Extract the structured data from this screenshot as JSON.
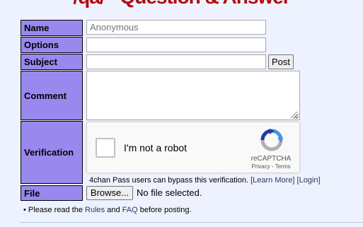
{
  "board": {
    "title": "/qa/ - Question & Answer"
  },
  "form": {
    "name": {
      "label": "Name",
      "placeholder": "Anonymous",
      "value": ""
    },
    "options": {
      "label": "Options",
      "value": ""
    },
    "subject": {
      "label": "Subject",
      "value": "",
      "post_label": "Post"
    },
    "comment": {
      "label": "Comment",
      "value": ""
    },
    "verification": {
      "label": "Verification",
      "captcha_text": "I'm not a robot",
      "brand": "reCAPTCHA",
      "privacy": "Privacy",
      "separator": " - ",
      "terms": "Terms",
      "checked": false,
      "bypass_text": "4chan Pass users can bypass this verification.",
      "learn_more": "[Learn More]",
      "login": "[Login]"
    },
    "file": {
      "label": "File",
      "browse_label": "Browse...",
      "status": "No file selected."
    }
  },
  "footer": {
    "bullet": "•",
    "please_read": "Please read the",
    "rules_link": "Rules",
    "and": "and",
    "faq_link": "FAQ",
    "before_posting": "before posting."
  },
  "colors": {
    "label_bg": "#9988ee",
    "page_bg": "#eef2ff",
    "title_red": "#af0a0f",
    "link": "#34345c"
  }
}
